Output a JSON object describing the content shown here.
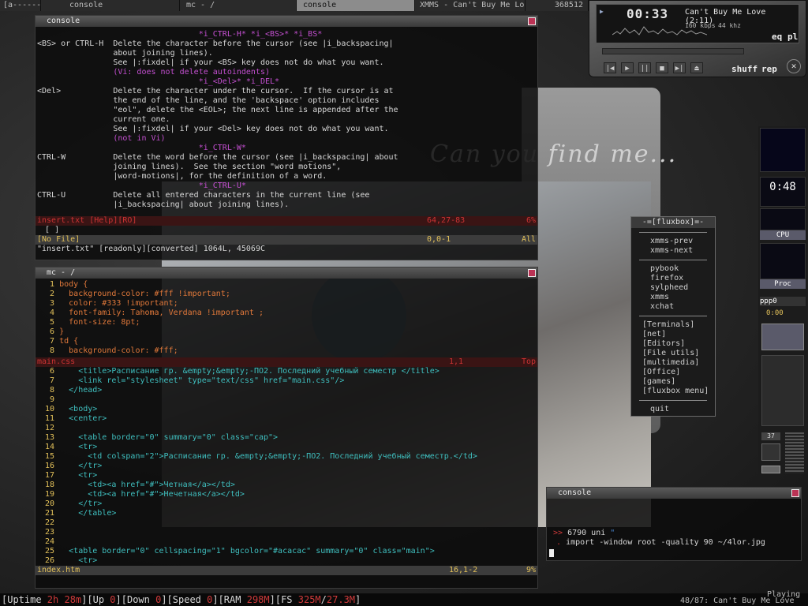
{
  "taskbar": {
    "tabs": [
      {
        "label": "[a------]"
      },
      {
        "label": "console"
      },
      {
        "label": "mc - /"
      },
      {
        "label": "console"
      },
      {
        "label": "XMMS - Can't Buy Me Love"
      }
    ],
    "counter": "368512"
  },
  "background": {
    "tagline": "Can you find me..."
  },
  "help_window": {
    "title": "console",
    "lines": [
      {
        "text": "                                  *i_CTRL-H* *i_<BS>* *i_BS*",
        "cls": "m"
      },
      {
        "text": "<BS> or CTRL-H  Delete the character before the cursor (see |i_backspacing|",
        "cls": "w"
      },
      {
        "text": "                about joining lines).",
        "cls": "w"
      },
      {
        "text": "                See |:fixdel| if your <BS> key does not do what you want.",
        "cls": "w"
      },
      {
        "text": "                (Vi: does not delete autoindents)",
        "cls": "m"
      },
      {
        "text": "                                  *i_<Del>* *i_DEL*",
        "cls": "m"
      },
      {
        "text": "<Del>           Delete the character under the cursor.  If the cursor is at",
        "cls": "w"
      },
      {
        "text": "                the end of the line, and the 'backspace' option includes",
        "cls": "w"
      },
      {
        "text": "                \"eol\", delete the <EOL>; the next line is appended after the",
        "cls": "w"
      },
      {
        "text": "                current one.",
        "cls": "w"
      },
      {
        "text": "                See |:fixdel| if your <Del> key does not do what you want.",
        "cls": "w"
      },
      {
        "text": "                (not in Vi)",
        "cls": "m"
      },
      {
        "text": "                                  *i_CTRL-W*",
        "cls": "m"
      },
      {
        "text": "CTRL-W          Delete the word before the cursor (see |i_backspacing| about",
        "cls": "w"
      },
      {
        "text": "                joining lines).  See the section \"word motions\",",
        "cls": "w"
      },
      {
        "text": "                |word-motions|, for the definition of a word.",
        "cls": "w"
      },
      {
        "text": "                                  *i_CTRL-U*",
        "cls": "m"
      },
      {
        "text": "CTRL-U          Delete all entered characters in the current line (see",
        "cls": "w"
      },
      {
        "text": "                |i_backspacing| about joining lines).",
        "cls": "w"
      }
    ],
    "status_file": "insert.txt [Help][RO]",
    "status_pos": "64,27-83",
    "status_pct": "6%",
    "bracket_line": "  [ ]",
    "nofile_name": "[No File]",
    "nofile_pos": "0,0-1",
    "nofile_pct": "All",
    "message": "\"insert.txt\" [readonly][converted] 1064L, 45069C"
  },
  "editor_window": {
    "title": "mc - /",
    "css_lines": [
      {
        "num": "1",
        "text": "body {"
      },
      {
        "num": "2",
        "text": "  background-color: #fff !important;"
      },
      {
        "num": "3",
        "text": "  color: #333 !important;"
      },
      {
        "num": "4",
        "text": "  font-family: Tahoma, Verdana !important ;"
      },
      {
        "num": "5",
        "text": "  font-size: 8pt;"
      },
      {
        "num": "6",
        "text": "}"
      },
      {
        "num": "7",
        "text": "td {"
      },
      {
        "num": "8",
        "text": "  background-color: #fff;"
      }
    ],
    "css_status_file": "main.css",
    "css_status_pos": "1,1",
    "css_status_pct": "Top",
    "html_lines": [
      {
        "num": "6",
        "text": "    <title>Расписание гр. &empty;&empty;-ПО2. Последний учебный семестр </title>"
      },
      {
        "num": "7",
        "text": "    <link rel=\"stylesheet\" type=\"text/css\" href=\"main.css\"/>"
      },
      {
        "num": "8",
        "text": "  </head>"
      },
      {
        "num": "9",
        "text": ""
      },
      {
        "num": "10",
        "text": "  <body>"
      },
      {
        "num": "11",
        "text": "  <center>"
      },
      {
        "num": "12",
        "text": ""
      },
      {
        "num": "13",
        "text": "    <table border=\"0\" summary=\"0\" class=\"cap\">"
      },
      {
        "num": "14",
        "text": "    <tr>"
      },
      {
        "num": "15",
        "text": "      <td colspan=\"2\">Расписание гр. &empty;&empty;-ПО2. Последний учебный семестр.</td>"
      },
      {
        "num": "16",
        "text": "    </tr>"
      },
      {
        "num": "17",
        "text": "    <tr>"
      },
      {
        "num": "18",
        "text": "      <td><a href=\"#\">Четная</a></td>"
      },
      {
        "num": "19",
        "text": "      <td><a href=\"#\">Нечетная</a></td>"
      },
      {
        "num": "20",
        "text": "    </tr>"
      },
      {
        "num": "21",
        "text": "    </table>"
      },
      {
        "num": "22",
        "text": ""
      },
      {
        "num": "23",
        "text": ""
      },
      {
        "num": "24",
        "text": ""
      },
      {
        "num": "25",
        "text": "  <table border=\"0\" cellspacing=\"1\" bgcolor=\"#acacac\" summary=\"0\" class=\"main\">"
      },
      {
        "num": "26",
        "text": "    <tr>"
      }
    ],
    "html_status_file": "index.htm",
    "html_status_pos": "16,1-2",
    "html_status_pct": "9%"
  },
  "xmms": {
    "time": "00:33",
    "track": "Can't Buy Me Love (2:11)",
    "kbps": "160",
    "kbps_unit": "kbps",
    "khz": "44",
    "khz_unit": "khz",
    "eq": "eq",
    "pl": "pl",
    "shuffle": "shuff",
    "repeat": "rep",
    "controls": [
      "|◀",
      "▶",
      "||",
      "■",
      "▶|",
      "⏏"
    ]
  },
  "fluxbox": {
    "title": "-=[fluxbox]=-",
    "group1": [
      "xmms-prev",
      "xmms-next"
    ],
    "group2": [
      "pybook",
      "firefox",
      "sylpheed",
      "xmms",
      "xchat"
    ],
    "group3": [
      "[Terminals]",
      "[net]",
      "[Editors]",
      "[File utils]",
      "[multimedia]",
      "[Office]",
      "[games]",
      "[fluxbox menu]"
    ],
    "quit": "quit"
  },
  "gkrellm": {
    "clock": "0:48",
    "cpu_label": "CPU",
    "proc_label": "Proc",
    "ppp_label": "ppp0",
    "ppp_time": "0:00",
    "volume": "37"
  },
  "console2": {
    "title": "console",
    "prompt1": ">>",
    "cmd1": "6790 uni",
    "cursor1": "\"",
    "prompt2": ".",
    "cmd2": "import -window root -quality 90 ~/4lor.jpg"
  },
  "statusbar": {
    "items": [
      {
        "label": "[Uptime ",
        "value": "2h 28m"
      },
      {
        "label": "][Up ",
        "value": "0"
      },
      {
        "label": "][Down ",
        "value": "0"
      },
      {
        "label": "][Speed ",
        "value": "0"
      },
      {
        "label": "][RAM ",
        "value": "298M"
      },
      {
        "label": "][FS ",
        "value": "325M"
      },
      {
        "label": "/",
        "value": "27.3M"
      },
      {
        "label": "]",
        "value": ""
      }
    ],
    "playing": "Playing",
    "now": "48/87: Can't Buy Me Love"
  }
}
